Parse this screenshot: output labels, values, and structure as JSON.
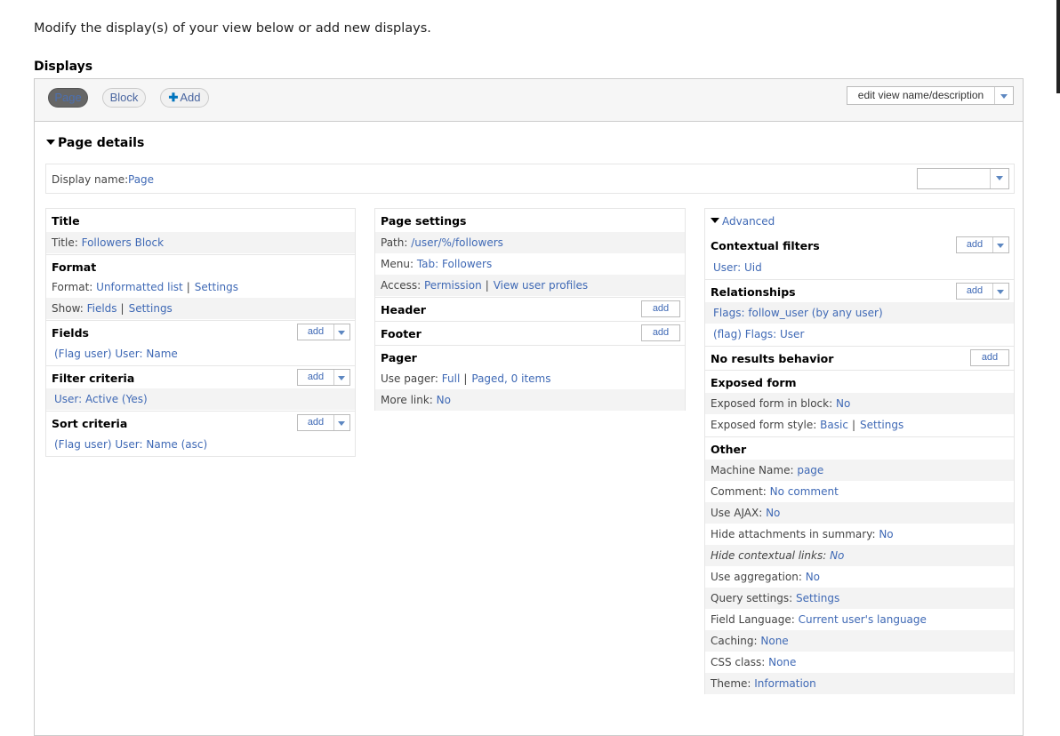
{
  "intro": "Modify the display(s) of your view below or add new displays.",
  "displays_heading": "Displays",
  "tabs": {
    "page": "Page",
    "block": "Block",
    "add_plus": "✚",
    "add": "Add"
  },
  "edit_view": "edit view name/description",
  "page_details": "Page details",
  "display_name": {
    "label": "Display name:",
    "value": "Page"
  },
  "left": {
    "title": {
      "heading": "Title",
      "label": "Title:",
      "value": "Followers Block"
    },
    "format": {
      "heading": "Format",
      "format_label": "Format:",
      "format_value": "Unformatted list",
      "format_settings": "Settings",
      "show_label": "Show:",
      "show_value": "Fields",
      "show_settings": "Settings"
    },
    "fields": {
      "heading": "Fields",
      "add": "add",
      "item": "(Flag user) User: Name"
    },
    "filter": {
      "heading": "Filter criteria",
      "add": "add",
      "item": "User: Active (Yes)"
    },
    "sort": {
      "heading": "Sort criteria",
      "add": "add",
      "item": "(Flag user) User: Name (asc)"
    }
  },
  "mid": {
    "page_settings": {
      "heading": "Page settings",
      "path_label": "Path:",
      "path_value": "/user/%/followers",
      "menu_label": "Menu:",
      "menu_value": "Tab: Followers",
      "access_label": "Access:",
      "access_value": "Permission",
      "access_perm": "View user profiles"
    },
    "header": {
      "heading": "Header",
      "add": "add"
    },
    "footer": {
      "heading": "Footer",
      "add": "add"
    },
    "pager": {
      "heading": "Pager",
      "use_label": "Use pager:",
      "use_value": "Full",
      "use_detail": "Paged, 0 items",
      "more_label": "More link:",
      "more_value": "No"
    }
  },
  "right": {
    "advanced": "Advanced",
    "contextual": {
      "heading": "Contextual filters",
      "add": "add",
      "item": "User: Uid"
    },
    "relationships": {
      "heading": "Relationships",
      "add": "add",
      "items": [
        "Flags: follow_user (by any user)",
        "(flag) Flags: User"
      ]
    },
    "no_results": {
      "heading": "No results behavior",
      "add": "add"
    },
    "exposed": {
      "heading": "Exposed form",
      "block_label": "Exposed form in block:",
      "block_value": "No",
      "style_label": "Exposed form style:",
      "style_value": "Basic",
      "style_settings": "Settings"
    },
    "other": {
      "heading": "Other",
      "rows": [
        {
          "label": "Machine Name:",
          "value": "page"
        },
        {
          "label": "Comment:",
          "value": "No comment"
        },
        {
          "label": "Use AJAX:",
          "value": "No"
        },
        {
          "label": "Hide attachments in summary:",
          "value": "No"
        },
        {
          "label": "Hide contextual links:",
          "value": "No"
        },
        {
          "label": "Use aggregation:",
          "value": "No"
        },
        {
          "label": "Query settings:",
          "value": "Settings"
        },
        {
          "label": "Field Language:",
          "value": "Current user's language"
        },
        {
          "label": "Caching:",
          "value": "None"
        },
        {
          "label": "CSS class:",
          "value": "None"
        },
        {
          "label": "Theme:",
          "value": "Information"
        }
      ]
    }
  }
}
